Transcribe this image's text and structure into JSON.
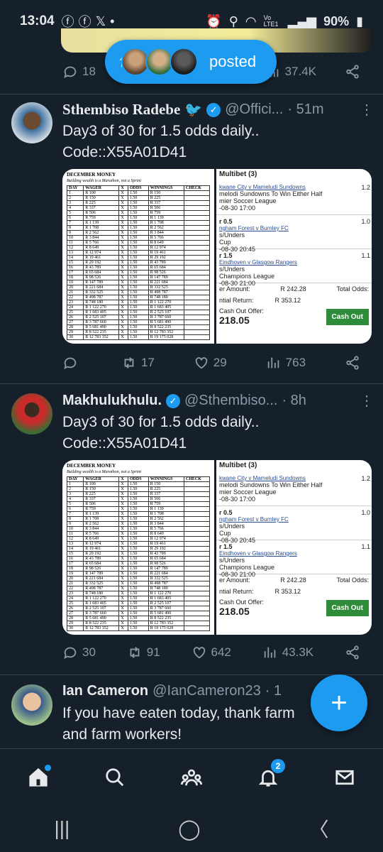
{
  "status": {
    "time": "13:04",
    "battery": "90%",
    "signal": "Vo LTE1"
  },
  "posted_pill": {
    "label": "posted"
  },
  "top_actions": {
    "replies": "18",
    "views": "37.4K"
  },
  "tweets": [
    {
      "name": "Sthembiso Radebe",
      "handle": "@Offici...",
      "time": "· 51m",
      "text_line1": "Day3 of 30 for 1.5 odds daily..",
      "text_line2": "Code::X55A01D41",
      "replies": "",
      "retweets": "17",
      "likes": "29",
      "views": "763"
    },
    {
      "name": "Makhulukhulu.",
      "handle": "@Sthembiso...",
      "time": "· 8h",
      "text_line1": "Day3 of 30 for 1.5 odds daily..",
      "text_line2": "Code::X55A01D41",
      "replies": "30",
      "retweets": "91",
      "likes": "642",
      "views": "43.3K"
    },
    {
      "name": "Ian Cameron",
      "handle": "@IanCameron23",
      "time": "· 1",
      "text_line1": "If you have eaten today, thank farm",
      "text_line2": "and farm workers!"
    }
  ],
  "sheet": {
    "title": "DECEMBER MONEY",
    "subtitle": "Building wealth is a Marathon, not a Sprint",
    "headers": [
      "DAY",
      "WAGER",
      "X",
      "ODDS",
      "WINNINGS",
      "CHECK"
    ],
    "rows": [
      [
        "1",
        "R 100",
        "X",
        "1.50",
        "R 150",
        ""
      ],
      [
        "2",
        "R 150",
        "X",
        "1.50",
        "R 225",
        ""
      ],
      [
        "3",
        "R 225",
        "X",
        "1.50",
        "R 337",
        ""
      ],
      [
        "4",
        "R 337",
        "X",
        "1.50",
        "R 506",
        ""
      ],
      [
        "5",
        "R 506",
        "X",
        "1.50",
        "R 759",
        ""
      ],
      [
        "6",
        "R 759",
        "X",
        "1.50",
        "R 1 139",
        ""
      ],
      [
        "7",
        "R 1 139",
        "X",
        "1.50",
        "R 1 708",
        ""
      ],
      [
        "8",
        "R 1 708",
        "X",
        "1.50",
        "R 2 562",
        ""
      ],
      [
        "9",
        "R 2 562",
        "X",
        "1.50",
        "R 3 844",
        ""
      ],
      [
        "10",
        "R 3 844",
        "X",
        "1.50",
        "R 5 766",
        ""
      ],
      [
        "11",
        "R 5 766",
        "X",
        "1.50",
        "R 8 649",
        ""
      ],
      [
        "12",
        "R 8 649",
        "X",
        "1.50",
        "R 12 974",
        ""
      ],
      [
        "13",
        "R 12 974",
        "X",
        "1.50",
        "R 19 461",
        ""
      ],
      [
        "14",
        "R 19 461",
        "X",
        "1.50",
        "R 29 192",
        ""
      ],
      [
        "15",
        "R 29 192",
        "X",
        "1.50",
        "R 43 789",
        ""
      ],
      [
        "16",
        "R 43 789",
        "X",
        "1.50",
        "R 65 684",
        ""
      ],
      [
        "17",
        "R 65 684",
        "X",
        "1.50",
        "R 98 526",
        ""
      ],
      [
        "18",
        "R 98 526",
        "X",
        "1.50",
        "R 147 789",
        ""
      ],
      [
        "19",
        "R 147 789",
        "X",
        "1.50",
        "R 221 684",
        ""
      ],
      [
        "20",
        "R 221 684",
        "X",
        "1.50",
        "R 332 525",
        ""
      ],
      [
        "21",
        "R 332 525",
        "X",
        "1.50",
        "R 498 787",
        ""
      ],
      [
        "22",
        "R 498 787",
        "X",
        "1.50",
        "R 748 180",
        ""
      ],
      [
        "23",
        "R 748 180",
        "X",
        "1.50",
        "R 1 122 270",
        ""
      ],
      [
        "24",
        "R 1 122 270",
        "X",
        "1.50",
        "R 1 683 405",
        ""
      ],
      [
        "25",
        "R 1 683 405",
        "X",
        "1.50",
        "R 2 525 107",
        ""
      ],
      [
        "26",
        "R 2 525 107",
        "X",
        "1.50",
        "R 3 787 660",
        ""
      ],
      [
        "27",
        "R 3 787 660",
        "X",
        "1.50",
        "R 5 681 490",
        ""
      ],
      [
        "28",
        "R 5 681 490",
        "X",
        "1.50",
        "R 8 522 235",
        ""
      ],
      [
        "29",
        "R 8 522 235",
        "X",
        "1.50",
        "R 12 783 352",
        ""
      ],
      [
        "30",
        "R 12 783 352",
        "X",
        "1.50",
        "R 19 175 028",
        ""
      ]
    ]
  },
  "betslip": {
    "header": "Multibet (3)",
    "legs": [
      {
        "market": "",
        "event": "kwane City v Mameludi Sundowns",
        "detail": "melodi Sundowns To Win Either Half",
        "league": "mier Soccer League",
        "date": "-08-30 17:00",
        "odds": "1.2"
      },
      {
        "market": "r 0.5",
        "event": "ngham Forest v Burnley FC",
        "detail": "s/Unders",
        "league": "Cup",
        "date": "-08-30 20:45",
        "odds": "1.0"
      },
      {
        "market": "r 1.5",
        "event": "Eindhoven v Glasgow Rangers",
        "detail": "s/Unders",
        "league": "Champions League",
        "date": "-08-30 21:00",
        "odds": "1.1"
      }
    ],
    "wager_label": "er Amount:",
    "wager_value": "R 242.28",
    "total_odds_label": "Total Odds:",
    "return_label": "ntial Return:",
    "return_value": "R 353.12",
    "cashout_label": "Cash Out Offer:",
    "cashout_value": "218.05",
    "cashout_button": "Cash Out"
  },
  "nav": {
    "notifications_count": "2"
  }
}
